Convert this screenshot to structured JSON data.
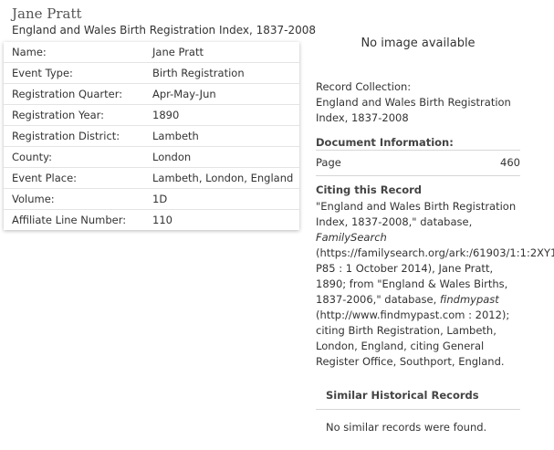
{
  "header": {
    "name": "Jane Pratt",
    "collection": "England and Wales Birth Registration Index, 1837-2008"
  },
  "details": [
    {
      "label": "Name:",
      "value": "Jane Pratt"
    },
    {
      "label": "Event Type:",
      "value": "Birth Registration"
    },
    {
      "label": "Registration Quarter:",
      "value": "Apr-May-Jun"
    },
    {
      "label": "Registration Year:",
      "value": "1890"
    },
    {
      "label": "Registration District:",
      "value": "Lambeth"
    },
    {
      "label": "County:",
      "value": "London"
    },
    {
      "label": "Event Place:",
      "value": "Lambeth, London, England"
    },
    {
      "label": "Volume:",
      "value": "1D"
    },
    {
      "label": "Affiliate Line Number:",
      "value": "110"
    }
  ],
  "sidebar": {
    "no_image": "No image available",
    "record_collection_label": "Record Collection:",
    "record_collection_value": "England and Wales Birth Registration Index, 1837-2008",
    "document_info_heading": "Document Information:",
    "page_label": "Page",
    "page_value": "460",
    "citing_heading": "Citing this Record",
    "citation": {
      "part1": "\"England and Wales Birth Registration Index, 1837-2008,\" database, ",
      "italic1": "FamilySearch",
      "part2": " (https://familysearch.org/ark:/61903/1:1:2XY1-P85 : 1 October 2014), Jane Pratt, 1890; from \"England & Wales Births, 1837-2006,\" database, ",
      "italic2": "findmypast",
      "part3": " (http://www.findmypast.com : 2012); citing Birth Registration, Lambeth, London, England, citing General Register Office, Southport, England."
    },
    "similar_heading": "Similar Historical Records",
    "similar_text": "No similar records were found."
  }
}
